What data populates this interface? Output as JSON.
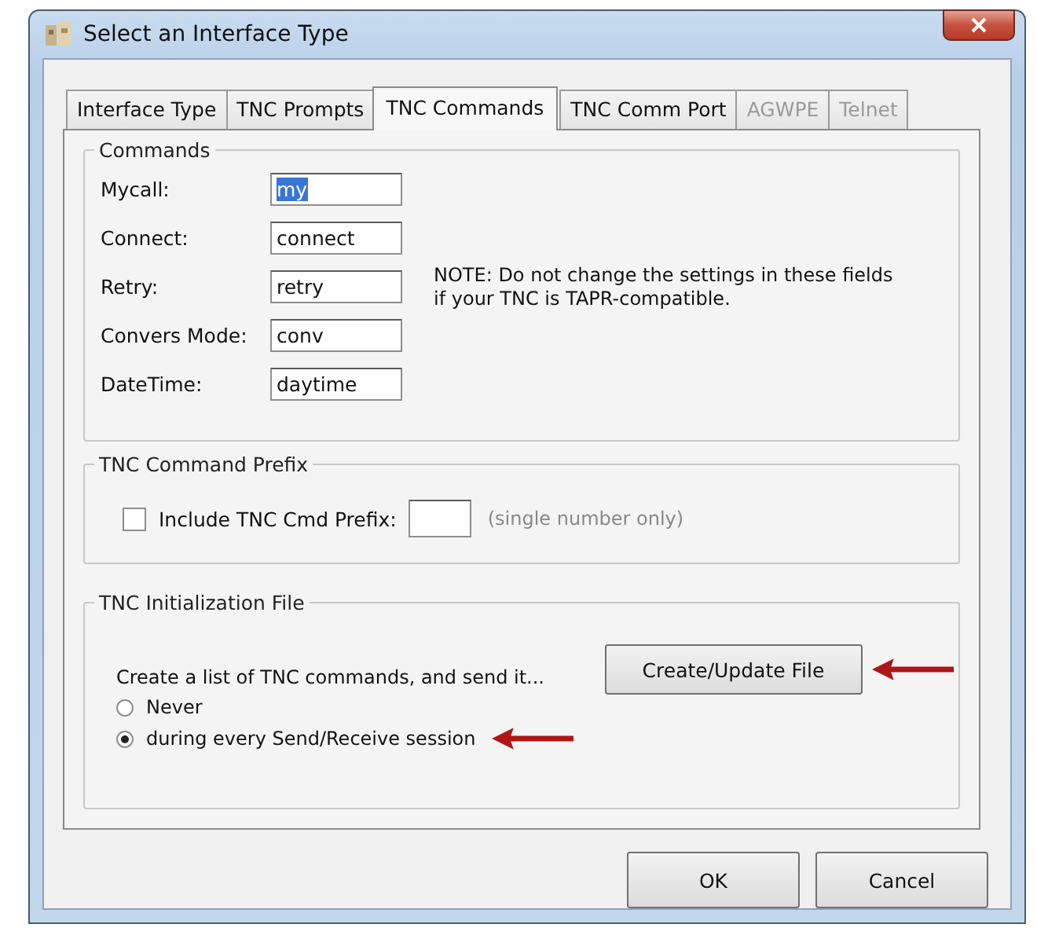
{
  "window": {
    "title": "Select an Interface Type"
  },
  "tabs": [
    {
      "label": "Interface Type",
      "selected": false,
      "disabled": false
    },
    {
      "label": "TNC Prompts",
      "selected": false,
      "disabled": false
    },
    {
      "label": "TNC Commands",
      "selected": true,
      "disabled": false
    },
    {
      "label": "TNC Comm Port",
      "selected": false,
      "disabled": false
    },
    {
      "label": "AGWPE",
      "selected": false,
      "disabled": true
    },
    {
      "label": "Telnet",
      "selected": false,
      "disabled": true
    }
  ],
  "commands": {
    "title": "Commands",
    "fields": [
      {
        "label": "Mycall:",
        "value": "my",
        "text_selected": true
      },
      {
        "label": "Connect:",
        "value": "connect",
        "text_selected": false
      },
      {
        "label": "Retry:",
        "value": "retry",
        "text_selected": false
      },
      {
        "label": "Convers Mode:",
        "value": "conv",
        "text_selected": false
      },
      {
        "label": "DateTime:",
        "value": "daytime",
        "text_selected": false
      }
    ],
    "note": "NOTE:  Do not change the settings in these fields if your TNC is TAPR-compatible."
  },
  "prefix": {
    "title": "TNC Command Prefix",
    "checkbox": {
      "label": "Include TNC Cmd Prefix:",
      "checked": false
    },
    "hint": "(single number only)"
  },
  "init_file": {
    "title": "TNC Initialization File",
    "prompt": "Create a list of TNC commands, and send it...",
    "options": [
      {
        "label": "Never",
        "selected": false
      },
      {
        "label": "during every Send/Receive session",
        "selected": true
      }
    ],
    "button": "Create/Update File"
  },
  "buttons": [
    "OK",
    "Cancel"
  ]
}
